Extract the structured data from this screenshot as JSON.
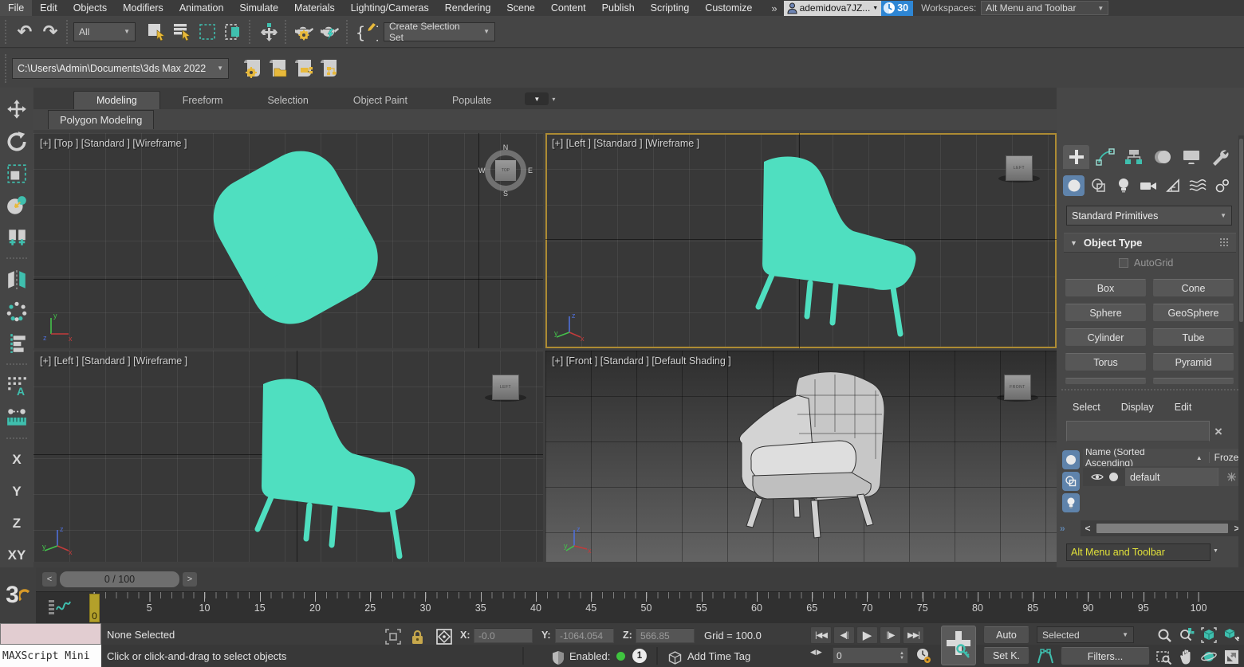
{
  "colors": {
    "teal_object": "#4FDFC0",
    "accent_yellow": "#E8B93B",
    "active_viewport_border": "#AD8B33",
    "workspace_text_yellow": "#E2E23A",
    "clock_badge_blue": "#2E86D4",
    "geometry_tab_blue": "#5F83AB"
  },
  "icons": {
    "undo": "↶",
    "redo": "↷",
    "caret_down": "▼",
    "overflow": "»",
    "clear_x": "×",
    "sort_asc": "▲",
    "left_arrow": "◀",
    "right_arrow": "▶",
    "go_start": "|◀◀",
    "prev_frame": "◀||",
    "play": "▶",
    "next_frame": "||▶",
    "go_end": "▶▶|",
    "spin_up": "▲",
    "spin_down": "▼",
    "left_small": "<",
    "right_small": ">"
  },
  "menubar": {
    "items": [
      "File",
      "Edit",
      "Objects",
      "Modifiers",
      "Animation",
      "Simulate",
      "Materials",
      "Lighting/Cameras",
      "Rendering",
      "Scene",
      "Content",
      "Publish",
      "Scripting",
      "Customize"
    ],
    "user_name": "ademidova7JZ...",
    "timer_badge": "30",
    "workspaces_label": "Workspaces:",
    "workspace_value": "Alt Menu and Toolbar"
  },
  "toolbar": {
    "selection_filter_value": "All",
    "create_selection_set_label": "Create Selection Set"
  },
  "pathbar": {
    "project_path": "C:\\Users\\Admin\\Documents\\3ds Max 2022"
  },
  "ribbon": {
    "tabs": [
      "Modeling",
      "Freeform",
      "Selection",
      "Object Paint",
      "Populate"
    ],
    "active_tab": "Modeling",
    "panel_tab": "Polygon Modeling"
  },
  "viewports": {
    "top_left": {
      "label": "[+] [Top ] [Standard ] [Wireframe ]",
      "viewcube": "TOP",
      "compass": {
        "n": "N",
        "e": "E",
        "s": "S",
        "w": "W"
      }
    },
    "top_right": {
      "label": "[+] [Left ] [Standard ] [Wireframe ]",
      "viewcube": "LEFT"
    },
    "bottom_left": {
      "label": "[+] [Left ] [Standard ] [Wireframe ]",
      "viewcube": "LEFT"
    },
    "bottom_right": {
      "label": "[+] [Front ]  [Standard ] [Default Shading ]",
      "viewcube": "FRONT"
    }
  },
  "command_panel": {
    "category_dropdown": "Standard Primitives",
    "rollout_title": "Object Type",
    "autogrid_label": "AutoGrid",
    "object_buttons": [
      "Box",
      "Cone",
      "Sphere",
      "GeoSphere",
      "Cylinder",
      "Tube",
      "Torus",
      "Pyramid"
    ]
  },
  "scene_explorer": {
    "menus": [
      "Select",
      "Display",
      "Edit"
    ],
    "search_value": "",
    "column_name": "Name (Sorted Ascending)",
    "column_frozen": "Frozen",
    "row_name": "default",
    "workspace_selector": "Alt Menu and Toolbar"
  },
  "timeline": {
    "frame_display": "0 / 100",
    "min": 0,
    "max": 100,
    "ticks": [
      0,
      5,
      10,
      15,
      20,
      25,
      30,
      35,
      40,
      45,
      50,
      55,
      60,
      65,
      70,
      75,
      80,
      85,
      90,
      95,
      100
    ],
    "current_frame_marker": "0"
  },
  "status_bar": {
    "maxscript_label": "MAXScript Mini",
    "selection_status": "None Selected",
    "prompt": "Click or click-and-drag to select objects",
    "x_label": "X:",
    "x_value": "-0.0",
    "y_label": "Y:",
    "y_value": "-1064.054",
    "z_label": "Z:",
    "z_value": "566.85",
    "grid_readout": "Grid = 100.0",
    "enabled_label": "Enabled:",
    "enabled_count": "1",
    "add_time_tag": "Add Time Tag",
    "frame_field": "0",
    "auto_button": "Auto",
    "set_key_button": "Set K.",
    "key_mode_dropdown": "Selected",
    "filters_button": "Filters..."
  }
}
